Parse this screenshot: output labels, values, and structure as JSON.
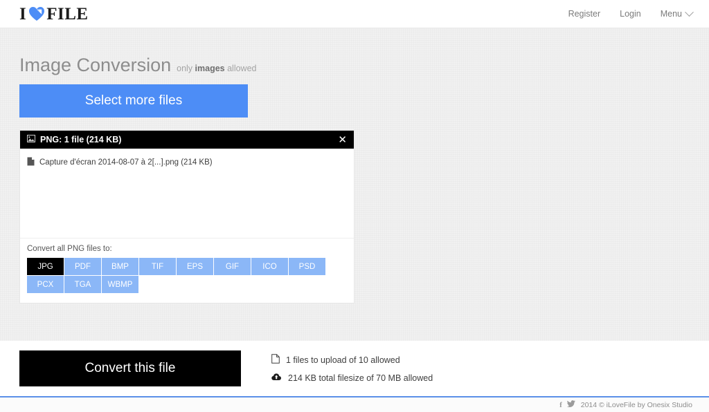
{
  "header": {
    "logo": {
      "pre": "I",
      "post": "FILE",
      "icon": "heart-icon"
    },
    "nav": [
      {
        "label": "Register",
        "name": "nav-register"
      },
      {
        "label": "Login",
        "name": "nav-login"
      },
      {
        "label": "Menu",
        "name": "nav-menu",
        "icon": "chevron-down-icon"
      }
    ]
  },
  "main": {
    "title": "Image Conversion",
    "subtitle_pre": "only ",
    "subtitle_strong": "images",
    "subtitle_post": " allowed",
    "select_button": "Select more files",
    "panel": {
      "icon": "image-icon",
      "title": "PNG: 1 file (214 KB)",
      "close": "✕",
      "files": [
        {
          "icon": "file-icon",
          "name": "Capture d'écran 2014-08-07 à 2[...].png (214 KB)"
        }
      ],
      "convert_label": "Convert all PNG files to:",
      "formats": [
        {
          "label": "JPG",
          "selected": true
        },
        {
          "label": "PDF",
          "selected": false
        },
        {
          "label": "BMP",
          "selected": false
        },
        {
          "label": "TIF",
          "selected": false
        },
        {
          "label": "EPS",
          "selected": false
        },
        {
          "label": "GIF",
          "selected": false
        },
        {
          "label": "ICO",
          "selected": false
        },
        {
          "label": "PSD",
          "selected": false
        },
        {
          "label": "PCX",
          "selected": false
        },
        {
          "label": "TGA",
          "selected": false
        },
        {
          "label": "WBMP",
          "selected": false
        }
      ]
    }
  },
  "bottom": {
    "convert_button": "Convert this file",
    "status": [
      {
        "icon": "document-outline-icon",
        "text": "1 files to upload of 10 allowed"
      },
      {
        "icon": "cloud-upload-icon",
        "text": "214 KB total filesize of 70 MB allowed"
      }
    ]
  },
  "footer": {
    "facebook": "f",
    "twitter": "twitter-icon",
    "copyright": "2014 © iLoveFile by Onesix Studio"
  },
  "colors": {
    "accent_blue": "#4d8df6",
    "format_blue": "#8bb7f7",
    "black": "#000000",
    "rule_blue": "#5b90e8"
  }
}
